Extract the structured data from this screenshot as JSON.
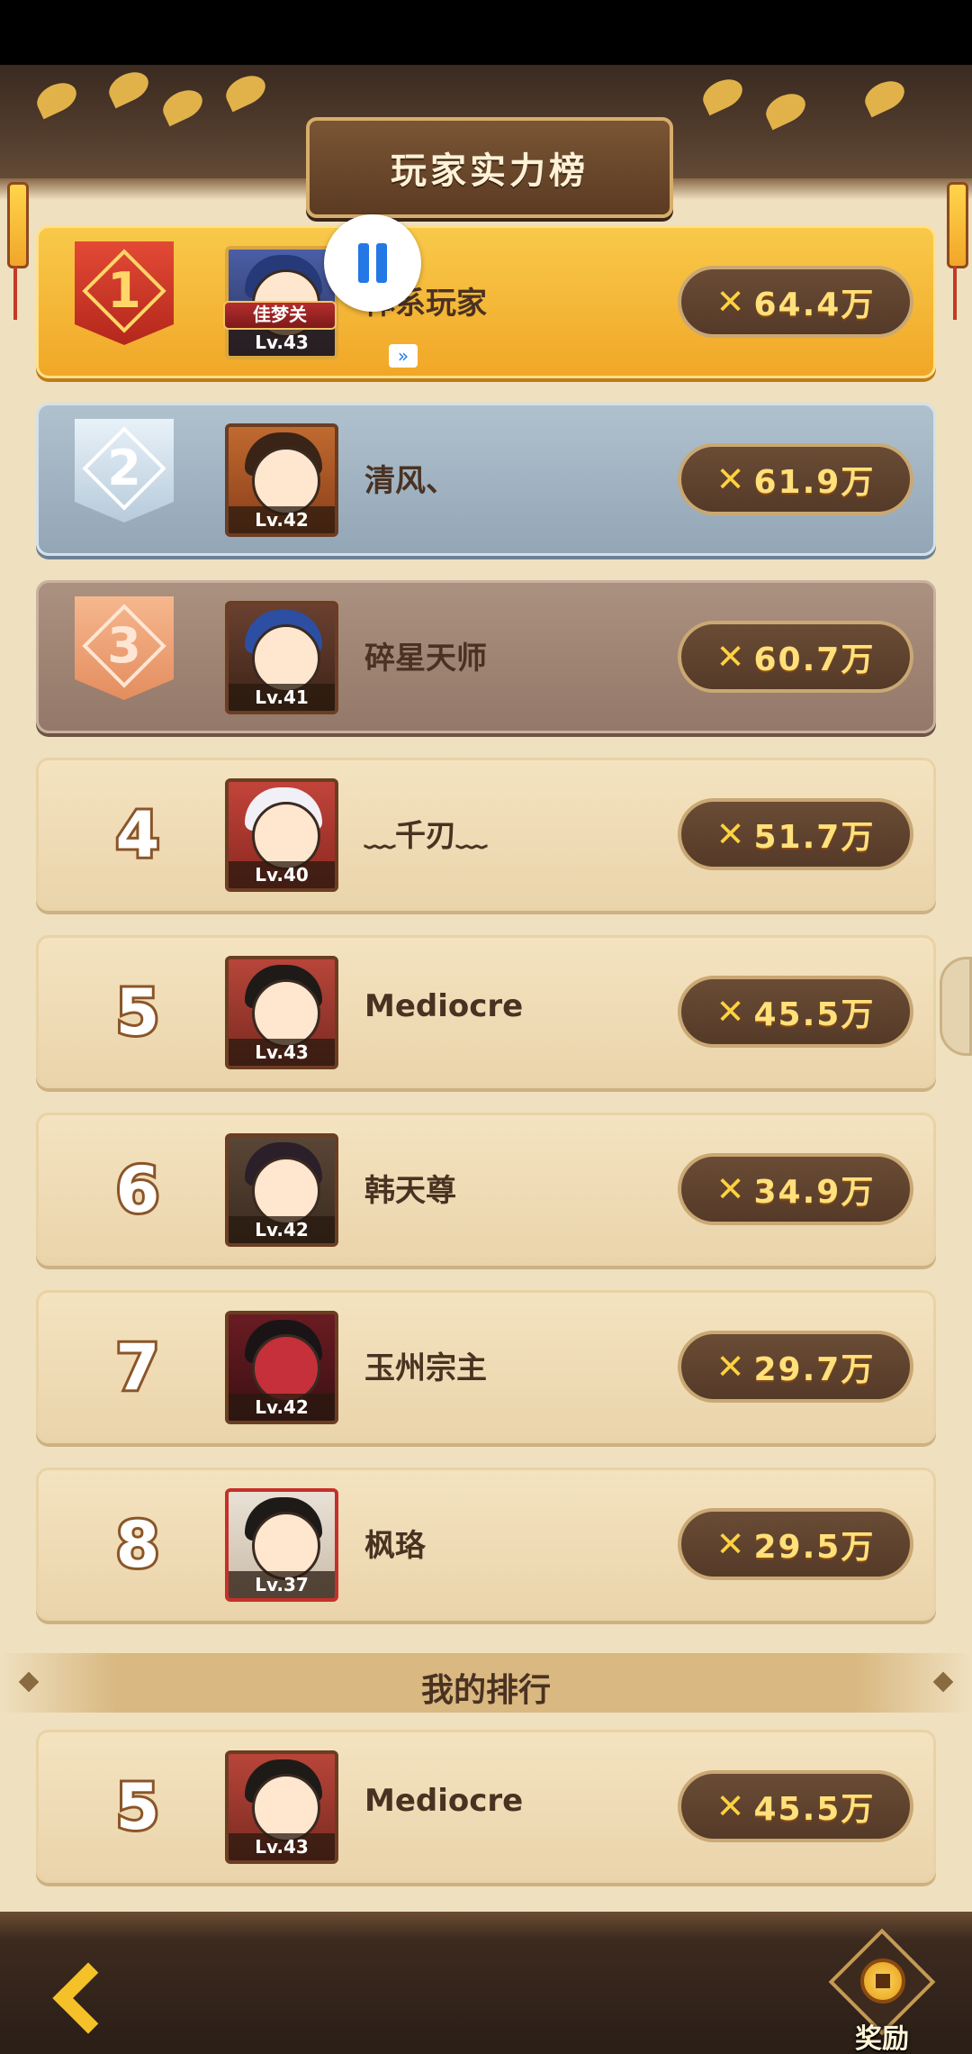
{
  "title": "玩家实力榜",
  "my_rank_header": "我的排行",
  "top_badge": "佳梦关",
  "reward_label": "奖励",
  "rows": [
    {
      "rank": "1",
      "level": "Lv.43",
      "name": "体系玩家",
      "power": "64.4万"
    },
    {
      "rank": "2",
      "level": "Lv.42",
      "name": "清风、",
      "power": "61.9万"
    },
    {
      "rank": "3",
      "level": "Lv.41",
      "name": "碎星天师",
      "power": "60.7万"
    },
    {
      "rank": "4",
      "level": "Lv.40",
      "name": "﹏千刃﹏",
      "power": "51.7万"
    },
    {
      "rank": "5",
      "level": "Lv.43",
      "name": "Mediocre",
      "power": "45.5万"
    },
    {
      "rank": "6",
      "level": "Lv.42",
      "name": "韩天尊",
      "power": "34.9万"
    },
    {
      "rank": "7",
      "level": "Lv.42",
      "name": "玉州宗主",
      "power": "29.7万"
    },
    {
      "rank": "8",
      "level": "Lv.37",
      "name": "枫珞",
      "power": "29.5万"
    }
  ],
  "my_row": {
    "rank": "5",
    "level": "Lv.43",
    "name": "Mediocre",
    "power": "45.5万"
  },
  "icons": {
    "power": "crossed-swords-icon",
    "back": "back-arrow-icon",
    "reward": "coin-icon",
    "overlay": "pause-icon"
  },
  "colors": {
    "gold_row": "#f3b12e",
    "silver_row": "#9fb1c0",
    "bronze_row": "#9d8273",
    "power_text": "#ffe07a"
  }
}
